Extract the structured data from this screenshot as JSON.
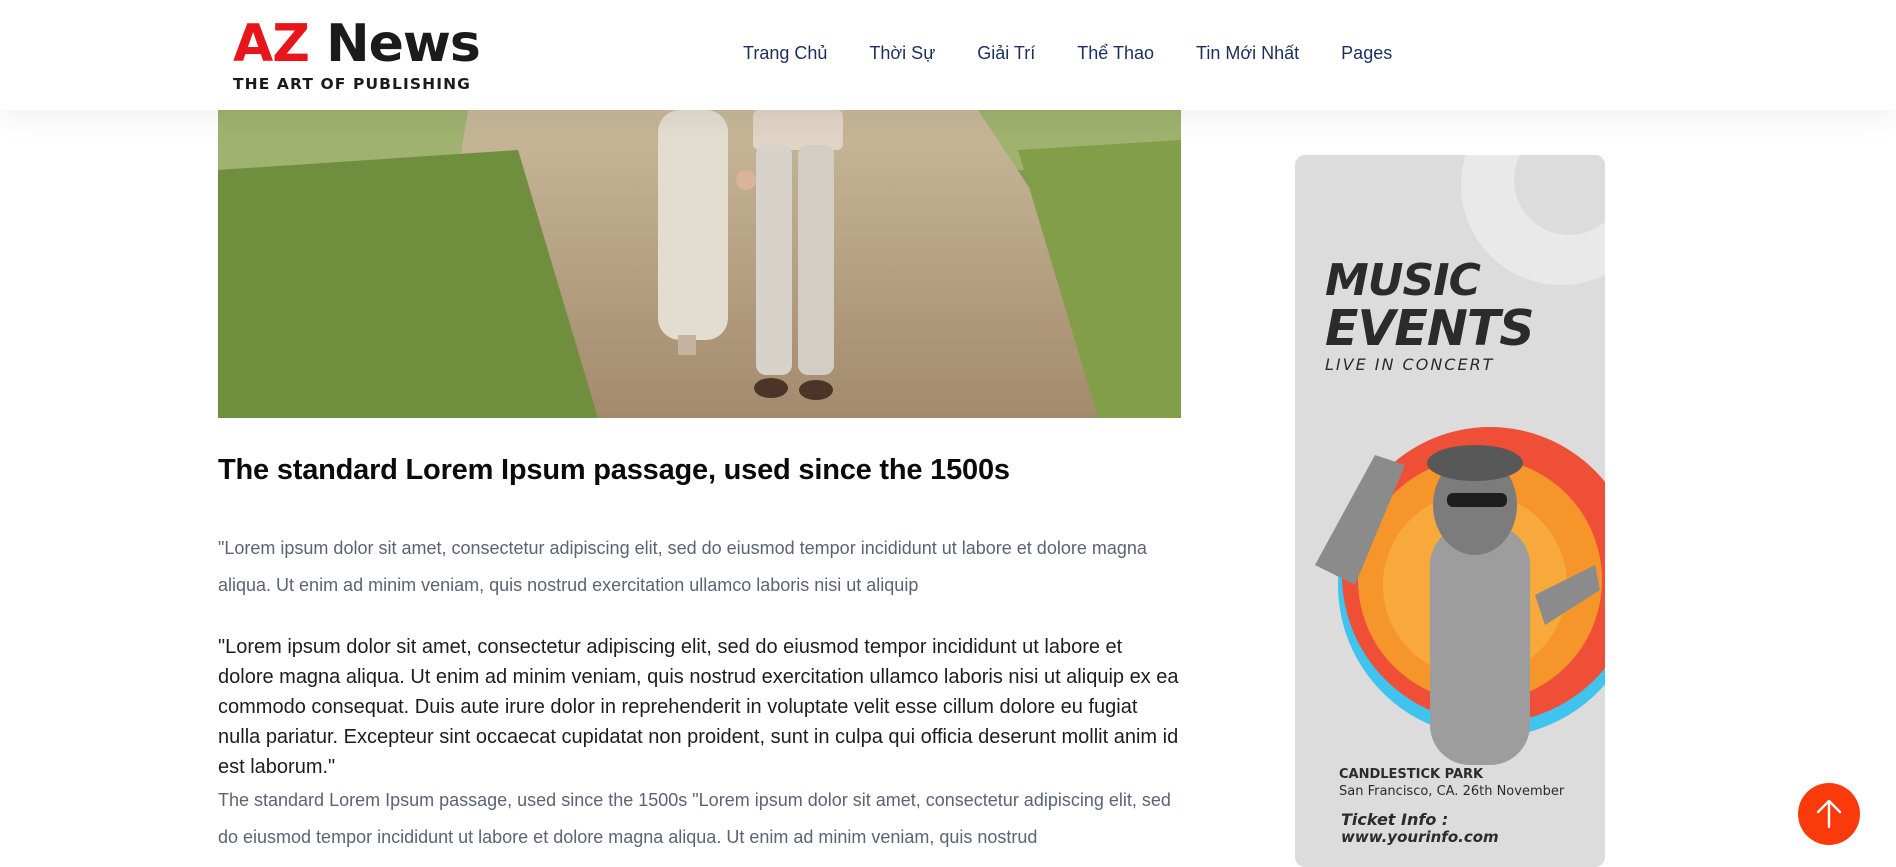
{
  "header": {
    "logo": {
      "brand_primary": "AZ",
      "brand_secondary": "News",
      "tagline": "THE ART OF PUBLISHING"
    },
    "nav": [
      {
        "label": "Trang Chủ"
      },
      {
        "label": "Thời Sự"
      },
      {
        "label": "Giải Trí"
      },
      {
        "label": "Thể Thao"
      },
      {
        "label": "Tin Mới Nhất"
      },
      {
        "label": "Pages"
      }
    ]
  },
  "article": {
    "title": "The standard Lorem Ipsum passage, used since the 1500s",
    "paragraph_1": "\"Lorem ipsum dolor sit amet, consectetur adipiscing elit, sed do eiusmod tempor incididunt ut labore et dolore magna aliqua. Ut enim ad minim veniam, quis nostrud exercitation ullamco laboris nisi ut aliquip",
    "quote": "\"Lorem ipsum dolor sit amet, consectetur adipiscing elit, sed do eiusmod tempor incididunt ut labore et dolore magna aliqua. Ut enim ad minim veniam, quis nostrud exercitation ullamco laboris nisi ut aliquip ex ea commodo consequat. Duis aute irure dolor in reprehenderit in voluptate velit esse cillum dolore eu fugiat nulla pariatur. Excepteur sint occaecat cupidatat non proident, sunt in culpa qui officia deserunt mollit anim id est laborum.\"",
    "paragraph_2": "The standard Lorem Ipsum passage, used since the 1500s \"Lorem ipsum dolor sit amet, consectetur adipiscing elit, sed do eiusmod tempor incididunt ut labore et dolore magna aliqua. Ut enim ad minim veniam, quis nostrud"
  },
  "sidebar_ad": {
    "title_line1": "MUSIC",
    "title_line2": "EVENTS",
    "subtitle": "LIVE IN CONCERT",
    "venue": "CANDLESTICK PARK",
    "city": "San Francisco, CA. 26th November",
    "ticket_label": "Ticket Info :",
    "ticket_url": "www.yourinfo.com"
  },
  "icons": {
    "back_to_top": "arrow-up-icon"
  },
  "colors": {
    "brand_red": "#e8151b",
    "nav_text": "#1a2f5c",
    "back_to_top_bg": "#fb3a0c"
  }
}
